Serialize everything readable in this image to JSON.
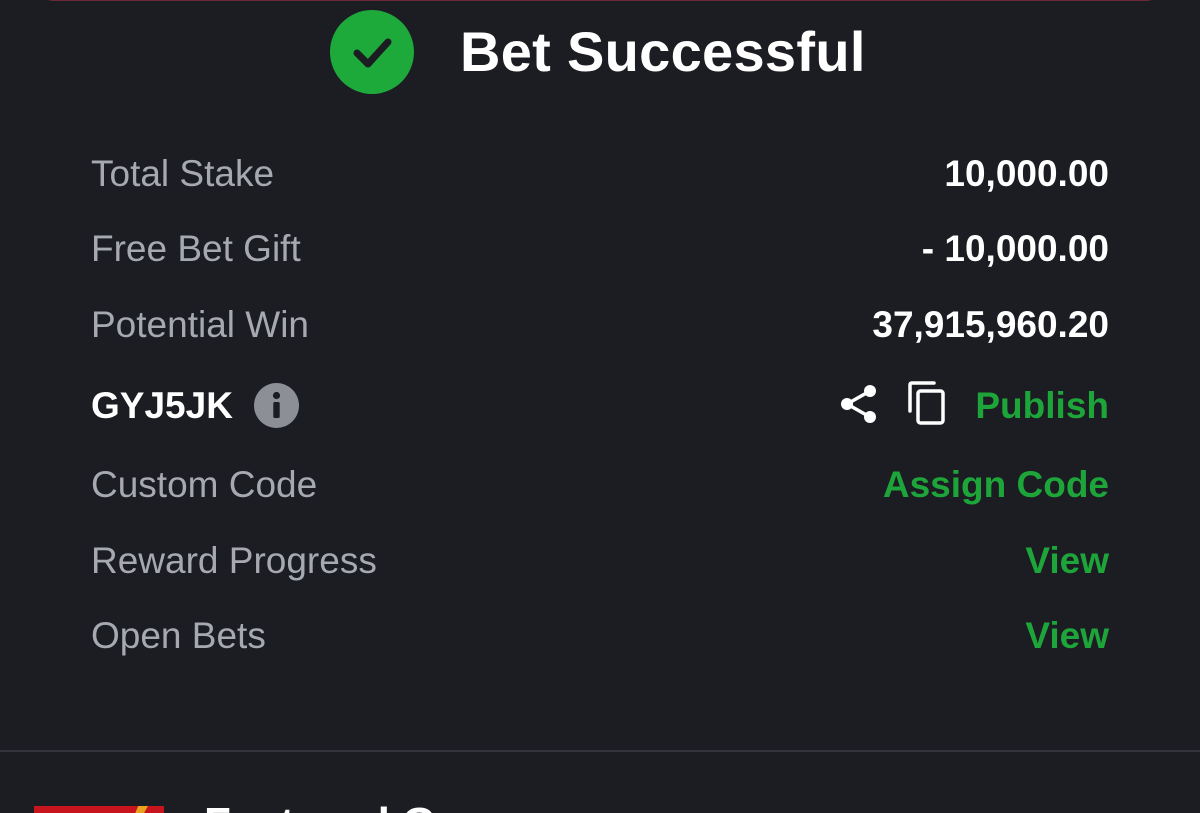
{
  "header": {
    "title": "Bet Successful",
    "icon": "check-circle-icon",
    "icon_color": "#1eaa3a"
  },
  "summary": {
    "total_stake": {
      "label": "Total Stake",
      "value": "10,000.00"
    },
    "free_bet_gift": {
      "label": "Free Bet Gift",
      "value": "- 10,000.00"
    },
    "potential_win": {
      "label": "Potential Win",
      "value": "37,915,960.20"
    }
  },
  "booking": {
    "code": "GYJ5JK",
    "info_icon": "info-icon",
    "share_icon": "share-icon",
    "copy_icon": "copy-icon",
    "publish_label": "Publish"
  },
  "custom_code": {
    "label": "Custom Code",
    "action": "Assign Code"
  },
  "reward_progress": {
    "label": "Reward Progress",
    "action": "View"
  },
  "open_bets": {
    "label": "Open Bets",
    "action": "View"
  },
  "bottom": {
    "title": "Featured G"
  },
  "colors": {
    "background": "#1b1d23",
    "accent_green": "#1ea53a",
    "label_gray": "#a7a9b1",
    "top_border": "#6a2a36"
  }
}
